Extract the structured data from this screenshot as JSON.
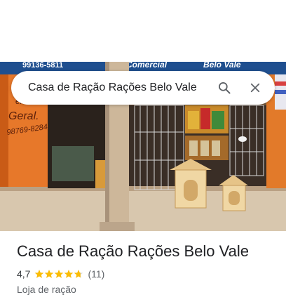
{
  "search": {
    "query": "Casa de Ração Rações Belo Vale"
  },
  "photo": {
    "sign_left": "99136-5811",
    "sign_mid": "Comercial",
    "sign_right": "Belo Vale",
    "wall_text_1": "em",
    "wall_text_2": "Geral.",
    "wall_text_3": "98769-8284"
  },
  "place": {
    "name": "Casa de Ração Rações Belo Vale",
    "rating": "4,7",
    "rating_fraction": 0.94,
    "review_count": "(11)",
    "category": "Loja de ração"
  },
  "colors": {
    "star": "#fbbc04",
    "text_primary": "#202124",
    "text_secondary": "#5f6368"
  }
}
